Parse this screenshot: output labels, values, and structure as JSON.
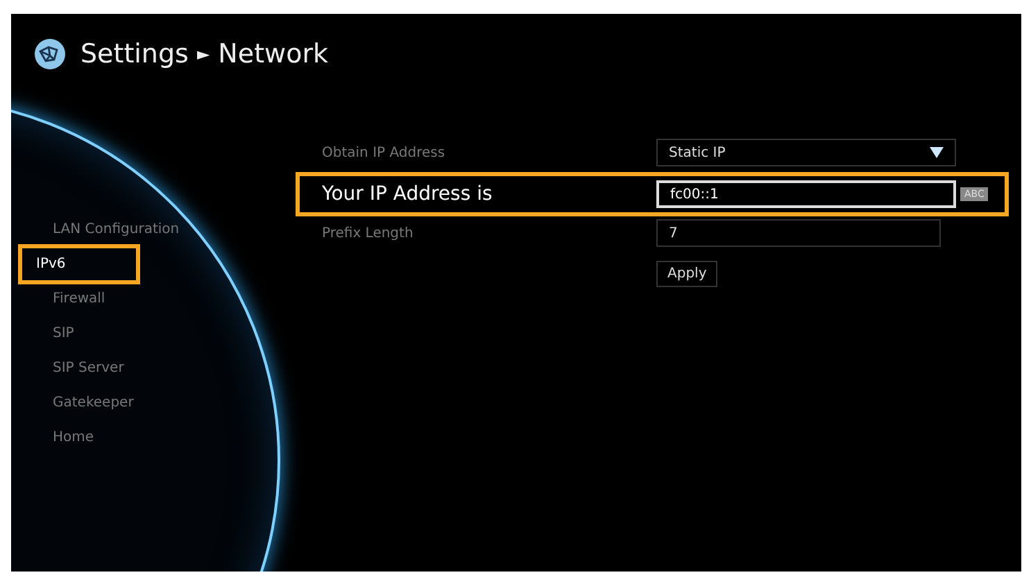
{
  "header": {
    "title": "Settings",
    "separator": "►",
    "subtitle": "Network"
  },
  "sidebar": {
    "items": [
      {
        "label": "LAN Configuration",
        "selected": false
      },
      {
        "label": "IPv6",
        "selected": true
      },
      {
        "label": "Firewall",
        "selected": false
      },
      {
        "label": "SIP",
        "selected": false
      },
      {
        "label": "SIP Server",
        "selected": false
      },
      {
        "label": "Gatekeeper",
        "selected": false
      },
      {
        "label": "Home",
        "selected": false
      }
    ]
  },
  "form": {
    "rows": [
      {
        "kind": "dropdown",
        "label": "Obtain IP Address",
        "value": "Static IP",
        "selected": false
      },
      {
        "kind": "text",
        "label": "Your IP Address is",
        "value": "fc00::1",
        "badge": "ABC",
        "selected": true
      },
      {
        "kind": "text",
        "label": "Prefix Length",
        "value": "7",
        "selected": false
      }
    ],
    "apply_button": "Apply"
  }
}
